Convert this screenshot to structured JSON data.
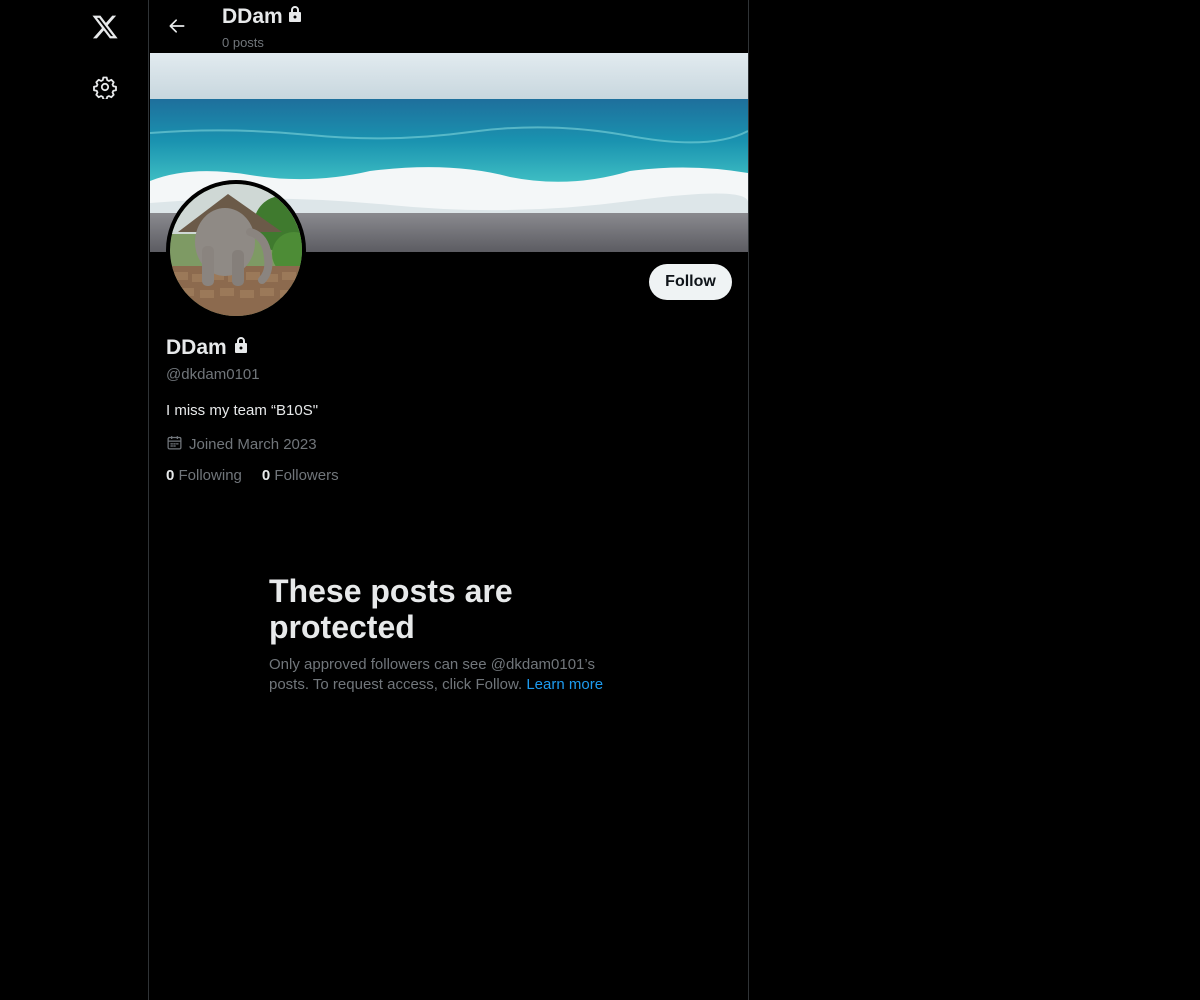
{
  "nav": {
    "logo_icon": "x-logo-icon",
    "settings_icon": "gear-icon"
  },
  "header": {
    "name": "DDam",
    "posts_count": "0 posts",
    "back_icon": "arrow-left-icon",
    "lock_icon": "lock-icon"
  },
  "profile": {
    "name": "DDam",
    "handle": "@dkdam0101",
    "bio": "I miss my team “B10S\"",
    "joined": "Joined March 2023",
    "follow_label": "Follow",
    "following_count": "0",
    "following_label": "Following",
    "followers_count": "0",
    "followers_label": "Followers"
  },
  "protected": {
    "title": "These posts are protected",
    "text": "Only approved followers can see @dkdam0101’s posts. To request access, click Follow. ",
    "learn_more": "Learn more"
  },
  "colors": {
    "background": "#000000",
    "text_primary": "#e7e9ea",
    "text_secondary": "#71767b",
    "link": "#1d9bf0",
    "follow_bg": "#eff3f4",
    "border": "#2f3336"
  }
}
